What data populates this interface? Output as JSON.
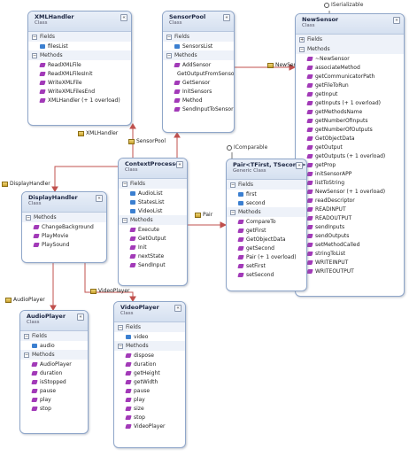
{
  "section_labels": {
    "fields": "Fields",
    "methods": "Methods"
  },
  "collapse_glyph": "«",
  "classes": {
    "xmlhandler": {
      "name": "XMLHandler",
      "kind": "Class",
      "fields": [
        "filesList"
      ],
      "methods": [
        "ReadXMLFile",
        "ReadXMLFilesInit",
        "WriteXMLFile",
        "WriteXMLFilesEnd",
        "XMLHandler (+ 1 overload)"
      ]
    },
    "sensorpool": {
      "name": "SensorPool",
      "kind": "Class",
      "fields": [
        "SensorsList"
      ],
      "methods": [
        "AddSensor",
        "GetOutputFromSensor",
        "GetSensor",
        "InitSensors",
        "Method",
        "SendInputToSensor"
      ]
    },
    "newsensor": {
      "name": "NewSensor",
      "kind": "Class",
      "methods": [
        "~NewSensor",
        "associateMethod",
        "getCommunicatorPath",
        "getFileToRun",
        "getInput",
        "getInputs (+ 1 overload)",
        "getMethodsName",
        "getNumberOfInputs",
        "getNumberOfOutputs",
        "GetObjectData",
        "getOutput",
        "getOutputs (+ 1 overload)",
        "getProp",
        "initSensorAPP",
        "listToString",
        "NewSensor (+ 1 overload)",
        "readDescriptor",
        "READINPUT",
        "READOUTPUT",
        "sendInputs",
        "sendOutputs",
        "setMethodCalled",
        "stringToList",
        "WRITEINPUT",
        "WRITEOUTPUT"
      ]
    },
    "contextprocessor": {
      "name": "ContextProcessor",
      "kind": "Class",
      "fields": [
        "AudioList",
        "StatesList",
        "VideoList"
      ],
      "methods": [
        "Execute",
        "GetOutput",
        "Init",
        "nextState",
        "SendInput"
      ]
    },
    "pair": {
      "name": "Pair<TFirst, TSecond>",
      "kind": "Generic Class",
      "fields": [
        "first",
        "second"
      ],
      "methods": [
        "CompareTo",
        "getFirst",
        "GetObjectData",
        "getSecond",
        "Pair (+ 1 overload)",
        "setFirst",
        "setSecond"
      ]
    },
    "displayhandler": {
      "name": "DisplayHandler",
      "kind": "Class",
      "methods": [
        "ChangeBackground",
        "PlayMovie",
        "PlaySound"
      ]
    },
    "audioplayer": {
      "name": "AudioPlayer",
      "kind": "Class",
      "fields": [
        "audio"
      ],
      "methods": [
        "AudioPlayer",
        "duration",
        "isStopped",
        "pause",
        "play",
        "stop"
      ]
    },
    "videoplayer": {
      "name": "VideoPlayer",
      "kind": "Class",
      "fields": [
        "video"
      ],
      "methods": [
        "dispose",
        "duration",
        "getHeight",
        "getWidth",
        "pause",
        "play",
        "size",
        "stop",
        "VideoPlayer"
      ]
    }
  },
  "associations": {
    "xmlhandler": "XMLHandler",
    "sensorpool": "SensorPool",
    "newsensor": "NewSensor",
    "displayhandler": "DisplayHandler",
    "pair": "Pair",
    "audioplayer": "AudioPlayer",
    "videoplayer": "VideoPlayer"
  },
  "interfaces": {
    "iserializable": "ISerializable",
    "icomparable": "IComparable"
  },
  "colors": {
    "wire": "#c0504d",
    "border": "#8fa6c9",
    "header": "#d5e0f0"
  }
}
